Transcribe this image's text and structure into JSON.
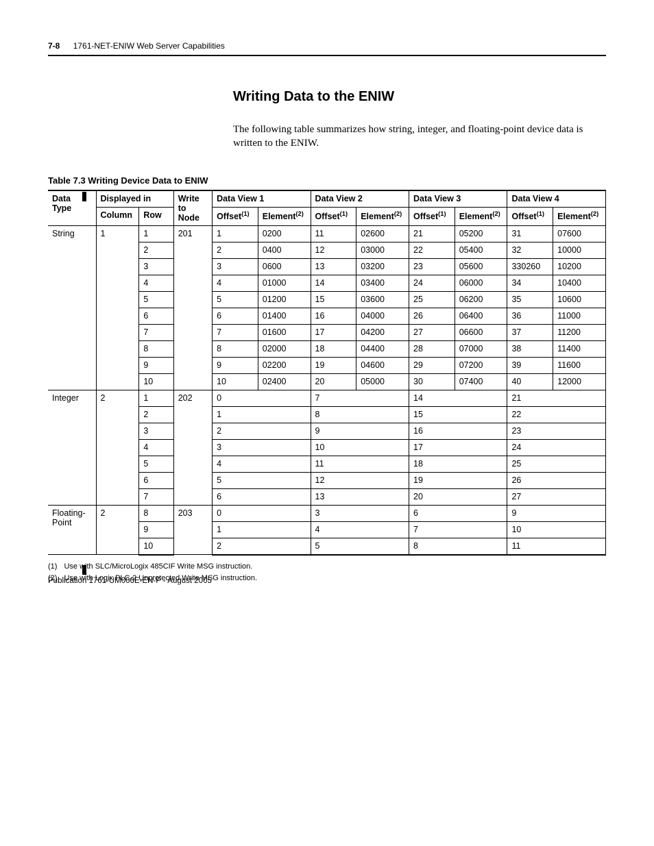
{
  "header": {
    "page_num": "7-8",
    "chapter_title": "1761-NET-ENIW Web Server Capabilities"
  },
  "section": {
    "heading": "Writing Data to the ENIW",
    "intro": "The following table summarizes how string, integer, and floating-point device data is written to the ENIW."
  },
  "table_caption": "Table 7.3 Writing Device Data to ENIW",
  "thead": {
    "data_type": "Data Type",
    "displayed_in": "Displayed in",
    "column": "Column",
    "row": "Row",
    "write_to_node": "Write to Node",
    "dv1": "Data View 1",
    "dv2": "Data View 2",
    "dv3": "Data View 3",
    "dv4": "Data View 4",
    "offset": "Offset",
    "element": "Element"
  },
  "rows": {
    "string": {
      "label": "String",
      "column": "1",
      "write_node": "201",
      "r": [
        {
          "row": "1",
          "o1": "1",
          "e1": "0200",
          "o2": "11",
          "e2": "02600",
          "o3": "21",
          "e3": "05200",
          "o4": "31",
          "e4": "07600"
        },
        {
          "row": "2",
          "o1": "2",
          "e1": "0400",
          "o2": "12",
          "e2": "03000",
          "o3": "22",
          "e3": "05400",
          "o4": "32",
          "e4": "10000"
        },
        {
          "row": "3",
          "o1": "3",
          "e1": "0600",
          "o2": "13",
          "e2": "03200",
          "o3": "23",
          "e3": "05600",
          "o4": "330260",
          "e4": "10200"
        },
        {
          "row": "4",
          "o1": "4",
          "e1": "01000",
          "o2": "14",
          "e2": "03400",
          "o3": "24",
          "e3": "06000",
          "o4": "34",
          "e4": "10400"
        },
        {
          "row": "5",
          "o1": "5",
          "e1": "01200",
          "o2": "15",
          "e2": "03600",
          "o3": "25",
          "e3": "06200",
          "o4": "35",
          "e4": "10600"
        },
        {
          "row": "6",
          "o1": "6",
          "e1": "01400",
          "o2": "16",
          "e2": "04000",
          "o3": "26",
          "e3": "06400",
          "o4": "36",
          "e4": "11000"
        },
        {
          "row": "7",
          "o1": "7",
          "e1": "01600",
          "o2": "17",
          "e2": "04200",
          "o3": "27",
          "e3": "06600",
          "o4": "37",
          "e4": "11200"
        },
        {
          "row": "8",
          "o1": "8",
          "e1": "02000",
          "o2": "18",
          "e2": "04400",
          "o3": "28",
          "e3": "07000",
          "o4": "38",
          "e4": "11400"
        },
        {
          "row": "9",
          "o1": "9",
          "e1": "02200",
          "o2": "19",
          "e2": "04600",
          "o3": "29",
          "e3": "07200",
          "o4": "39",
          "e4": "11600"
        },
        {
          "row": "10",
          "o1": "10",
          "e1": "02400",
          "o2": "20",
          "e2": "05000",
          "o3": "30",
          "e3": "07400",
          "o4": "40",
          "e4": "12000"
        }
      ]
    },
    "integer": {
      "label": "Integer",
      "column": "2",
      "write_node": "202",
      "r": [
        {
          "row": "1",
          "v1": "0",
          "v2": "7",
          "v3": "14",
          "v4": "21"
        },
        {
          "row": "2",
          "v1": "1",
          "v2": "8",
          "v3": "15",
          "v4": "22"
        },
        {
          "row": "3",
          "v1": "2",
          "v2": "9",
          "v3": "16",
          "v4": "23"
        },
        {
          "row": "4",
          "v1": "3",
          "v2": "10",
          "v3": "17",
          "v4": "24"
        },
        {
          "row": "5",
          "v1": "4",
          "v2": "11",
          "v3": "18",
          "v4": "25"
        },
        {
          "row": "6",
          "v1": "5",
          "v2": "12",
          "v3": "19",
          "v4": "26"
        },
        {
          "row": "7",
          "v1": "6",
          "v2": "13",
          "v3": "20",
          "v4": "27"
        }
      ]
    },
    "float": {
      "label": "Floating-Point",
      "column": "2",
      "write_node": "203",
      "r": [
        {
          "row": "8",
          "v1": "0",
          "v2": "3",
          "v3": "6",
          "v4": "9"
        },
        {
          "row": "9",
          "v1": "1",
          "v2": "4",
          "v3": "7",
          "v4": "10"
        },
        {
          "row": "10",
          "v1": "2",
          "v2": "5",
          "v3": "8",
          "v4": "11"
        }
      ]
    }
  },
  "footnotes": {
    "f1_num": "(1)",
    "f1": "Use with SLC/MicroLogix 485CIF Write MSG instruction.",
    "f2_num": "(2)",
    "f2": "Use with Logix PLC-2 Unprotected Write MSG instruction."
  },
  "publication": "Publication 1761-UM006E-EN-P - August 2005"
}
